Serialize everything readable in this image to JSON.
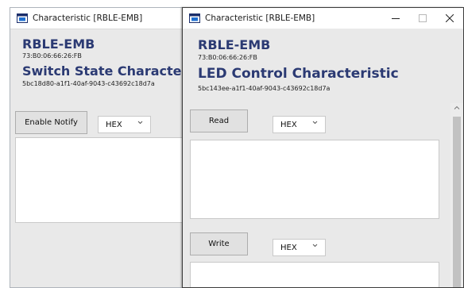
{
  "back_window": {
    "title": "Characteristic [RBLE-EMB]",
    "device_name": "RBLE-EMB",
    "device_address": "73:B0:06:66:26:FB",
    "characteristic_name": "Switch State Characteristic",
    "uuid": "5bc18d80-a1f1-40af-9043-c43692c18d7a",
    "enable_notify_label": "Enable Notify",
    "format_value": "HEX"
  },
  "front_window": {
    "title": "Characteristic [RBLE-EMB]",
    "device_name": "RBLE-EMB",
    "device_address": "73:B0:06:66:26:FB",
    "characteristic_name": "LED Control Characteristic",
    "uuid": "5bc143ee-a1f1-40af-9043-c43692c18d7a",
    "read_label": "Read",
    "read_format_value": "HEX",
    "write_label": "Write",
    "write_format_value": "HEX"
  },
  "icons": {
    "app": "app-window-icon",
    "minimize": "minimize-icon",
    "maximize": "maximize-icon",
    "close": "close-icon",
    "dropdown": "chevron-down-icon",
    "scroll_up": "chevron-up-icon"
  },
  "colors": {
    "heading": "#2b3a73",
    "window_body": "#e9e9e9",
    "button": "#e1e1e1"
  }
}
